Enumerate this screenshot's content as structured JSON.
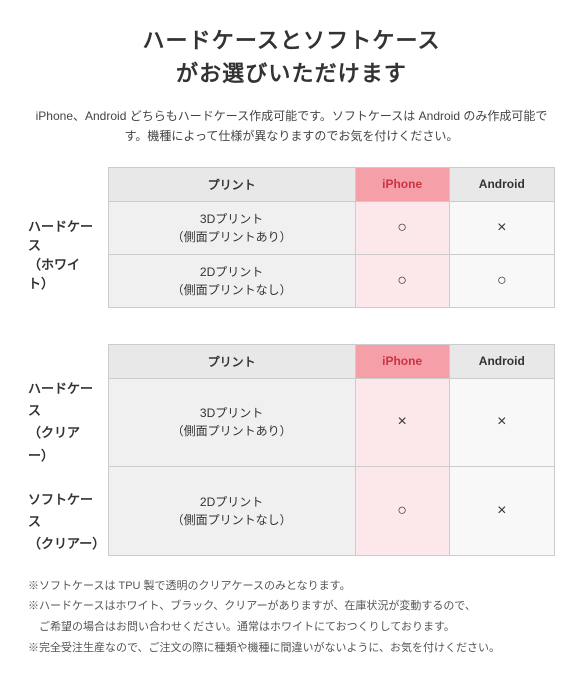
{
  "title": {
    "line1": "ハードケースとソフトケース",
    "line2": "がお選びいただけます"
  },
  "description": "iPhone、Android どちらもハードケース作成可能です。ソフトケースは\nAndroid のみ作成可能です。機種によって仕様が異なりますのでお気を付けください。",
  "table1": {
    "row_header": "ハードケース\n（ホワイト）",
    "col_print": "プリント",
    "col_iphone": "iPhone",
    "col_android": "Android",
    "rows": [
      {
        "print": "3D プリント\n（側面プリントあり）",
        "iphone": "○",
        "android": "×"
      },
      {
        "print": "2D プリント\n（側面プリントなし）",
        "iphone": "○",
        "android": "○"
      }
    ]
  },
  "table2": {
    "row_header1": "ハードケース\n（クリアー）",
    "row_header2": "ソフトケース\n（クリアー）",
    "col_print": "プリント",
    "col_iphone": "iPhone",
    "col_android": "Android",
    "rows": [
      {
        "print": "3D プリント\n（側面プリントあり）",
        "iphone": "×",
        "android": "×"
      },
      {
        "print": "2D プリント\n（側面プリントなし）",
        "iphone": "○",
        "android": "×"
      }
    ]
  },
  "notes": [
    "※ソフトケースは TPU 製で透明のクリアケースのみとなります。",
    "※ハードケースはホワイト、ブラック、クリアーがありますが、在庫状況が変動するので、\n　ご希望の場合はお問い合わせください。通常はホワイトにておつくりしております。",
    "※完全受注生産なので、ご注文の際に種類や機種に間違いがないように、お気を付けください。"
  ]
}
